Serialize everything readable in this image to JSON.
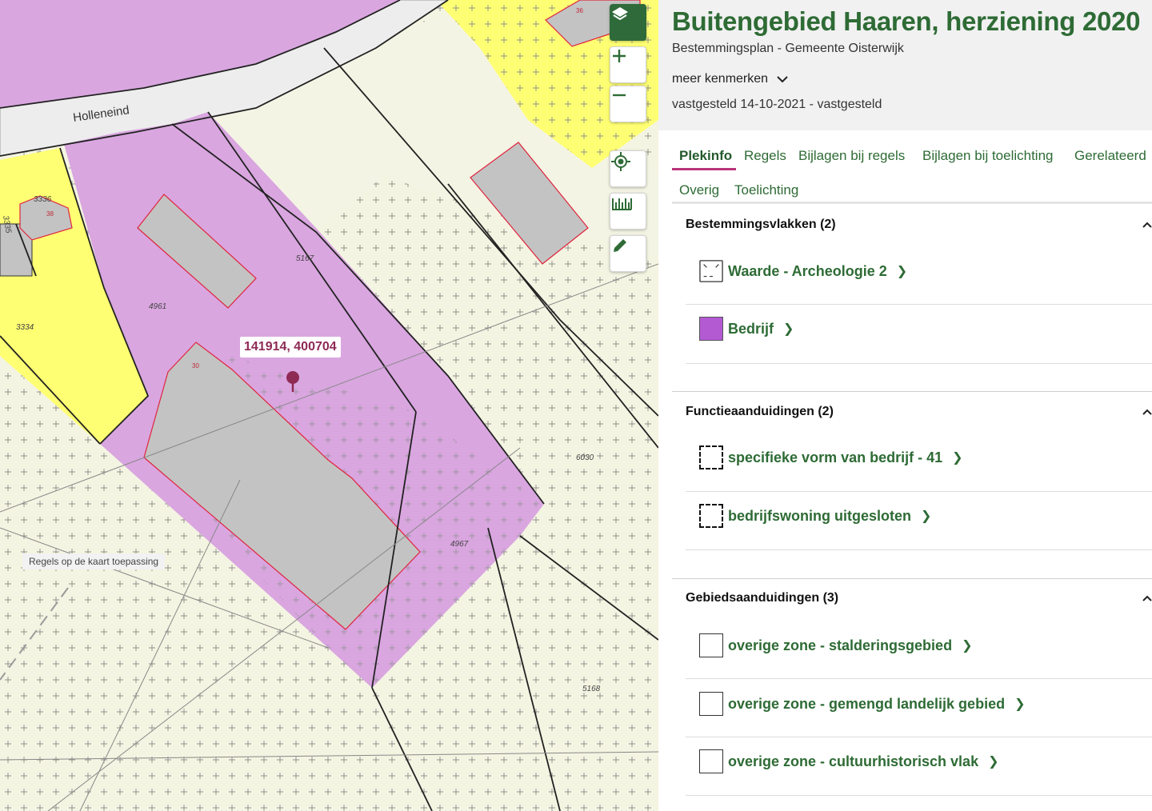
{
  "map": {
    "street_label": "Holleneind",
    "parcel_numbers": [
      "3336",
      "3335",
      "3334",
      "4961",
      "5167",
      "4967",
      "6030",
      "5168"
    ],
    "building_numbers": [
      "36",
      "38",
      "30"
    ],
    "coordinates": "141914, 400704",
    "hint": "Regels op de kaart toepassing",
    "controls": {
      "layers": "layers-icon",
      "zoom_in": "plus-icon",
      "zoom_out": "minus-icon",
      "locate": "locate-icon",
      "measure": "ruler-icon",
      "draw": "pencil-icon"
    },
    "colors": {
      "bedrijf": "#d9a6e0",
      "wonen": "#ffff73",
      "agrarisch": "#f4f4e2",
      "building": "#c3c3c3",
      "building_outline": "#e0243d",
      "pin": "#8e2a54"
    }
  },
  "plan": {
    "title": "Buitengebied Haaren, herziening 2020",
    "subtitle": "Bestemmingsplan - Gemeente Oisterwijk",
    "more_label": "meer kenmerken",
    "status": "vastgesteld 14-10-2021 - vastgesteld"
  },
  "tabs": [
    "Plekinfo",
    "Regels",
    "Bijlagen bij regels",
    "Bijlagen bij toelichting",
    "Gerelateerd",
    "Overig",
    "Toelichting"
  ],
  "active_tab": "Plekinfo",
  "sections": [
    {
      "title": "Bestemmingsvlakken (2)",
      "items": [
        {
          "label": "Waarde - Archeologie 2",
          "swatch": "dashed-outline"
        },
        {
          "label": "Bedrijf",
          "swatch": "purple"
        }
      ]
    },
    {
      "title": "Functieaanduidingen (2)",
      "items": [
        {
          "label": "specifieke vorm van bedrijf - 41",
          "swatch": "dashed-black"
        },
        {
          "label": "bedrijfswoning uitgesloten",
          "swatch": "dashed-black"
        }
      ]
    },
    {
      "title": "Gebiedsaanduidingen (3)",
      "items": [
        {
          "label": "overige zone - stalderingsgebied",
          "swatch": "outline"
        },
        {
          "label": "overige zone - gemengd landelijk gebied",
          "swatch": "outline"
        },
        {
          "label": "overige zone - cultuurhistorisch vlak",
          "swatch": "outline"
        }
      ]
    }
  ],
  "accent": "#2e6b35",
  "bedrijf_swatch_color": "#b35ad3"
}
